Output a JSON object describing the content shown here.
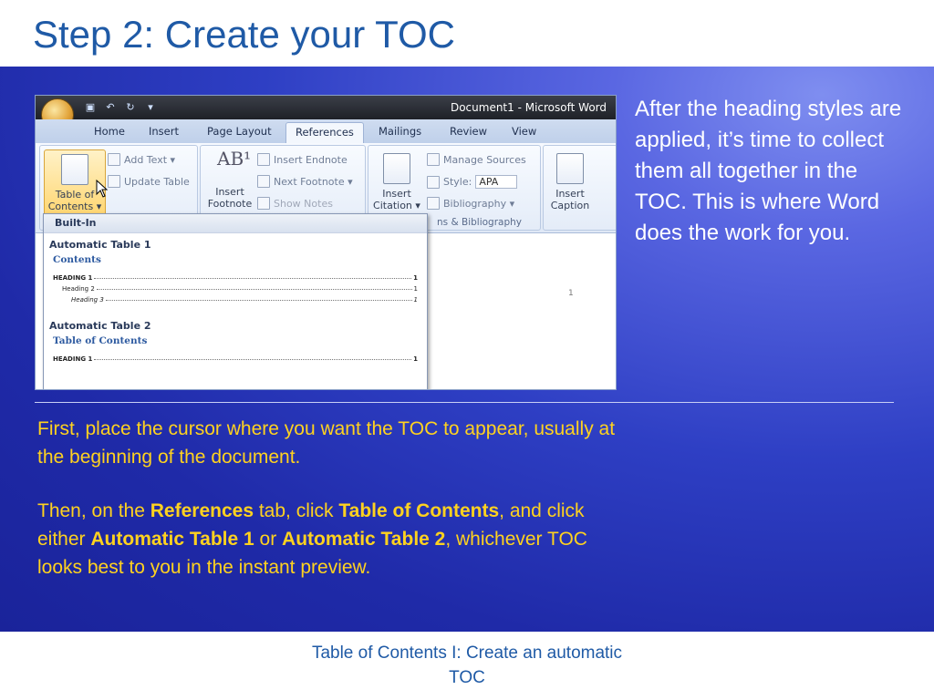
{
  "slide": {
    "title": "Step 2: Create your TOC",
    "right_text": "After the heading styles are applied, it’s time to collect them all together in the TOC. This is where Word does the work for you.",
    "body_first": "First, place the cursor where you want the TOC to appear, usually at the beginning of the document.",
    "body_second": {
      "t1": "Then, on the ",
      "b1": "References",
      "t2": " tab, click ",
      "b2": "Table of Contents",
      "t3": ", and click either ",
      "b3": "Automatic Table 1",
      "t4": " or ",
      "b4": "Automatic Table 2",
      "t5": ", whichever TOC looks best to you in the instant preview."
    },
    "footer": "Table of Contents I: Create an automatic TOC"
  },
  "word": {
    "window_title": "Document1 - Microsoft Word",
    "tabs": [
      "Home",
      "Insert",
      "Page Layout",
      "References",
      "Mailings",
      "Review",
      "View"
    ],
    "active_tab": "References",
    "toc_button": "Table of Contents",
    "toc_button_line1": "Table of",
    "toc_button_line2": "Contents ▾",
    "add_text": "Add Text ▾",
    "update_table": "Update Table",
    "insert_footnote_l1": "Insert",
    "insert_footnote_l2": "Footnote",
    "insert_endnote": "Insert Endnote",
    "next_footnote": "Next Footnote ▾",
    "show_notes": "Show Notes",
    "insert_citation_l1": "Insert",
    "insert_citation_l2": "Citation ▾",
    "manage_sources": "Manage Sources",
    "style_label": "Style:",
    "style_value": "APA",
    "bibliography": "Bibliography ▾",
    "group_label_citations": "ns & Bibliography",
    "insert_caption_l1": "Insert",
    "insert_caption_l2": "Caption",
    "page_number": "1",
    "dropdown": {
      "header": "Built-In",
      "section1": "Automatic Table 1",
      "card1_title": "Contents",
      "card1_lines": [
        {
          "text": "HEADING 1",
          "page": "1"
        },
        {
          "text": "Heading 2",
          "page": "1"
        },
        {
          "text": "Heading 3",
          "page": "1"
        }
      ],
      "section2": "Automatic Table 2",
      "card2_title": "Table of Contents",
      "card2_lines": [
        {
          "text": "HEADING 1",
          "page": "1"
        }
      ]
    }
  },
  "colors": {
    "title": "#1f5aa6",
    "body_text": "#ffd21f",
    "panel_dark": "#1f2aa8",
    "panel_light": "#7f8ef0"
  }
}
